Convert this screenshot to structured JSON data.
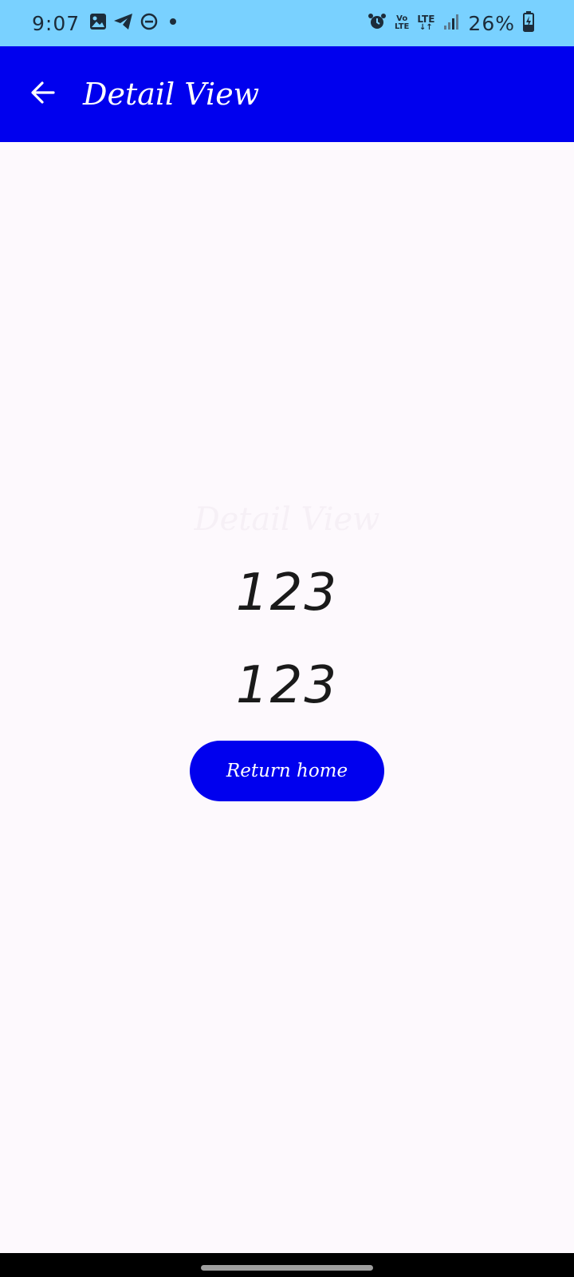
{
  "status_bar": {
    "time": "9:07",
    "battery": "26%",
    "volte_top": "Vo",
    "volte_bottom": "LTE",
    "lte": "LTE",
    "lte_arrows": "↓↑",
    "icons": [
      "gallery-icon",
      "telegram-icon",
      "dnd-icon",
      "notification-dot-icon",
      "alarm-icon",
      "volte-icon",
      "signal-icon",
      "battery-charging-icon"
    ]
  },
  "app_bar": {
    "title": "Detail View",
    "back_icon": "arrow-left-icon",
    "background": "#0000ee"
  },
  "content": {
    "ghost_title": "Detail View",
    "value_1": "123",
    "value_2": "123"
  },
  "return_button": {
    "label": "Return home",
    "background": "#0000ee"
  }
}
